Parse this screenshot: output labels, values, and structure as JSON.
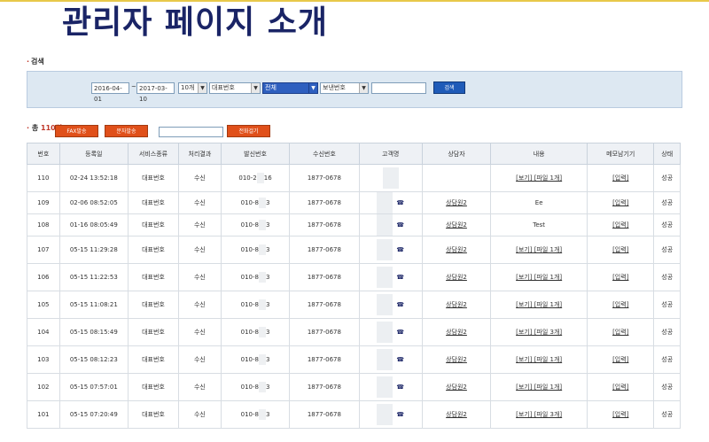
{
  "slide_title": "관리자 페이지 소개",
  "search_section": {
    "label": "검색"
  },
  "search": {
    "date_from": "2016-04-01",
    "date_sep": "~",
    "date_to": "2017-03-10",
    "per_page": "10개",
    "field_select": "대표번호",
    "scope_select": "전체",
    "type_select": "보낸번호",
    "keyword": "",
    "search_button": "검색"
  },
  "summary": {
    "prefix": "총",
    "count": "110건"
  },
  "actions": {
    "fax_button": "FAX발송",
    "sms_button": "문자발송",
    "call_input": "",
    "call_button": "전화걸기"
  },
  "columns": [
    "번호",
    "등록일",
    "서비스종류",
    "처리결과",
    "발신번호",
    "수신번호",
    "고객명",
    "상담자",
    "내용",
    "메모남기기",
    "상태"
  ],
  "rows": [
    {
      "no": "110",
      "date": "02-24 13:52:18",
      "service": "대표번호",
      "result": "수신",
      "from": "010-2",
      "from_tail": "16",
      "to": "1877-0678",
      "agent": "",
      "content": "[보기] [파일 1개]",
      "memo": "[입력]",
      "status": "성공"
    },
    {
      "no": "109",
      "date": "02-06 08:52:05",
      "service": "대표번호",
      "result": "수신",
      "from": "010-8",
      "from_tail": "3",
      "to": "1877-0678",
      "agent": "상담원2",
      "content": "Ee",
      "memo": "[입력]",
      "status": "성공"
    },
    {
      "no": "108",
      "date": "01-16 08:05:49",
      "service": "대표번호",
      "result": "수신",
      "from": "010-8",
      "from_tail": "3",
      "to": "1877-0678",
      "agent": "상담원2",
      "content": "Test",
      "memo": "[입력]",
      "status": "성공"
    },
    {
      "no": "107",
      "date": "05-15 11:29:28",
      "service": "대표번호",
      "result": "수신",
      "from": "010-8",
      "from_tail": "3",
      "to": "1877-0678",
      "agent": "상담원2",
      "content": "[보기] [파일 1개]",
      "memo": "[입력]",
      "status": "성공"
    },
    {
      "no": "106",
      "date": "05-15 11:22:53",
      "service": "대표번호",
      "result": "수신",
      "from": "010-8",
      "from_tail": "3",
      "to": "1877-0678",
      "agent": "상담원2",
      "content": "[보기] [파일 1개]",
      "memo": "[입력]",
      "status": "성공"
    },
    {
      "no": "105",
      "date": "05-15 11:08:21",
      "service": "대표번호",
      "result": "수신",
      "from": "010-8",
      "from_tail": "3",
      "to": "1877-0678",
      "agent": "상담원2",
      "content": "[보기] [파일 1개]",
      "memo": "[입력]",
      "status": "성공"
    },
    {
      "no": "104",
      "date": "05-15 08:15:49",
      "service": "대표번호",
      "result": "수신",
      "from": "010-8",
      "from_tail": "3",
      "to": "1877-0678",
      "agent": "상담원2",
      "content": "[보기] [파일 3개]",
      "memo": "[입력]",
      "status": "성공"
    },
    {
      "no": "103",
      "date": "05-15 08:12:23",
      "service": "대표번호",
      "result": "수신",
      "from": "010-8",
      "from_tail": "3",
      "to": "1877-0678",
      "agent": "상담원2",
      "content": "[보기] [파일 1개]",
      "memo": "[입력]",
      "status": "성공"
    },
    {
      "no": "102",
      "date": "05-15 07:57:01",
      "service": "대표번호",
      "result": "수신",
      "from": "010-8",
      "from_tail": "3",
      "to": "1877-0678",
      "agent": "상담원2",
      "content": "[보기] [파일 1개]",
      "memo": "[입력]",
      "status": "성공"
    },
    {
      "no": "101",
      "date": "05-15 07:20:49",
      "service": "대표번호",
      "result": "수신",
      "from": "010-8",
      "from_tail": "3",
      "to": "1877-0678",
      "agent": "상담원2",
      "content": "[보기] [파일 3개]",
      "memo": "[입력]",
      "status": "성공"
    }
  ]
}
